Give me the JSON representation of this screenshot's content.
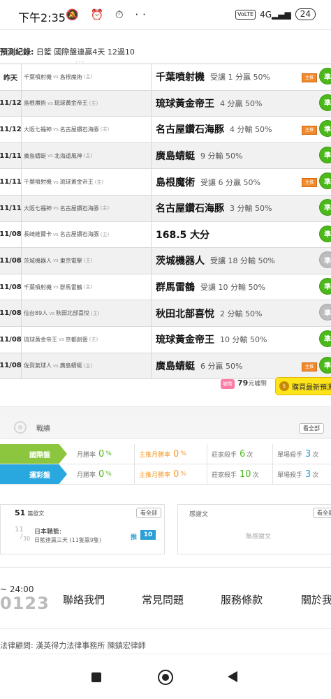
{
  "status_bar": {
    "time": "下午2:35",
    "icons": "🔕 ⏰ ⏱ ··",
    "volte": "VoLTE",
    "net": "4G",
    "battery": "24"
  },
  "prediction": {
    "header_label": "預測紀錄:",
    "header_text": "日籃 國際盤連贏4天 12過10"
  },
  "rows": [
    {
      "date": "昨天",
      "home": "千葉噴射機",
      "away": "島根魔術",
      "away_tag": "(主)",
      "pick": "千葉噴射機",
      "result": "受讓 1 分贏 50%",
      "hot": true,
      "badge": "準",
      "badge_color": "green"
    },
    {
      "date": "11/12",
      "home": "島根魔術",
      "away": "琉球黃金帝王",
      "away_tag": "(主)",
      "pick": "琉球黃金帝王",
      "result": "4 分贏 50%",
      "hot": false,
      "badge": "準",
      "badge_color": "green"
    },
    {
      "date": "11/12",
      "home": "大阪七福神",
      "away": "名古屋鑽石海豚",
      "away_tag": "(主)",
      "pick": "名古屋鑽石海豚",
      "result": "4 分輸 50%",
      "hot": true,
      "badge": "準",
      "badge_color": "green"
    },
    {
      "date": "11/11",
      "home": "廣島蜻蜓",
      "away": "北海道風神",
      "away_tag": "(主)",
      "pick": "廣島蜻蜓",
      "result": "9 分輸 50%",
      "hot": false,
      "badge": "準",
      "badge_color": "green"
    },
    {
      "date": "11/11",
      "home": "千葉噴射機",
      "away": "琉球黃金帝王",
      "away_tag": "(主)",
      "pick": "島根魔術",
      "result": "受讓 6 分贏 50%",
      "hot": true,
      "badge": "準",
      "badge_color": "green"
    },
    {
      "date": "11/11",
      "home": "大阪七福神",
      "away": "名古屋鑽石海豚",
      "away_tag": "(主)",
      "pick": "名古屋鑽石海豚",
      "result": "3 分輸 50%",
      "hot": false,
      "badge": "準",
      "badge_color": "green"
    },
    {
      "date": "11/08",
      "home": "長崎維爾卡",
      "away": "名古屋鑽石海豚",
      "away_tag": "(主)",
      "pick": "168.5 大分",
      "result": "",
      "hot": false,
      "badge": "準",
      "badge_color": "green"
    },
    {
      "date": "11/08",
      "home": "茨城機器人",
      "away": "東京電擊",
      "away_tag": "(主)",
      "pick": "茨城機器人",
      "result": "受讓 18 分輸 50%",
      "hot": false,
      "badge": "準",
      "badge_color": "grey"
    },
    {
      "date": "11/08",
      "home": "千葉噴射機",
      "away": "群馬雷鶴",
      "away_tag": "(主)",
      "pick": "群馬雷鶴",
      "result": "受讓 10 分輸 50%",
      "hot": false,
      "badge": "準",
      "badge_color": "green"
    },
    {
      "date": "11/08",
      "home": "仙台89人",
      "away": "秋田北部喜悅",
      "away_tag": "(主)",
      "pick": "秋田北部喜悅",
      "result": "2 分輸 50%",
      "hot": false,
      "badge": "準",
      "badge_color": "grey"
    },
    {
      "date": "11/08",
      "home": "琉球黃金帝王",
      "away": "京都創藝",
      "away_tag": "(主)",
      "pick": "琉球黃金帝王",
      "result": "10 分輸 50%",
      "hot": false,
      "badge": "準",
      "badge_color": "green"
    },
    {
      "date": "11/08",
      "home": "佐賀氣球人",
      "away": "廣島蜻蜓",
      "away_tag": "(主)",
      "pick": "廣島蜻蜓",
      "result": "6 分贏 50%",
      "hot": true,
      "badge": "準",
      "badge_color": "green"
    }
  ],
  "vs_text": "vs",
  "hot_icon_label": "主推",
  "purchase": {
    "price": "79",
    "unit": "元噱幣",
    "coin_icon": "噱幣",
    "button_label": "購買最新預測"
  },
  "record": {
    "title": "戰績",
    "see_all": "看全部",
    "rows": [
      {
        "label": "國際盤",
        "color": "#8cc63f",
        "win_rate_label": "月勝率",
        "win_rate": "0",
        "pct": "%",
        "main_rate_label": "主推月勝率",
        "main_rate": "0",
        "pct2": "%",
        "killer_label": "莊家殺手",
        "killer": "6",
        "killer_unit": "次",
        "single_label": "單場殺手",
        "single": "3",
        "single_unit": "次"
      },
      {
        "label": "運彩盤",
        "color": "#29a8e0",
        "win_rate_label": "月勝率",
        "win_rate": "0",
        "pct": "%",
        "main_rate_label": "主推月勝率",
        "main_rate": "0",
        "pct2": "%",
        "killer_label": "莊家殺手",
        "killer": "10",
        "killer_unit": "次",
        "single_label": "單場殺手",
        "single": "3",
        "single_unit": "次"
      }
    ]
  },
  "posts": {
    "count": "51",
    "count_label": "篇發文",
    "see_all": "看全部",
    "item": {
      "day": "11",
      "month": "30",
      "title": "日本職籃:",
      "subtitle": "日籃連贏三天 (11隻贏9隻)",
      "tui": "推",
      "tui_count": "10"
    },
    "pager": "•••"
  },
  "thanks": {
    "title": "感謝文",
    "see_all": "看全部",
    "empty": "無感謝文"
  },
  "footer": {
    "hours": "~ 24:00",
    "number": "0123",
    "links": [
      "聯絡我們",
      "常見問題",
      "服務條款",
      "關於我"
    ],
    "legal": "法律顧問: 漢英得力法律事務所 陳鎮宏律師"
  }
}
